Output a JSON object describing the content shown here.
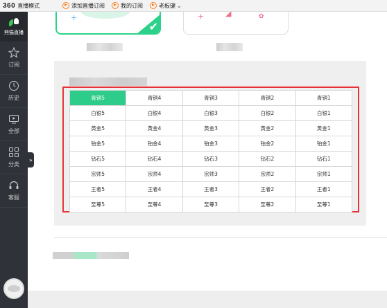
{
  "topbar": {
    "brand_number": "360",
    "brand_label": "直播模式",
    "items": [
      {
        "label": "添加直播订阅"
      },
      {
        "label": "我的订阅"
      },
      {
        "label": "老板键"
      }
    ]
  },
  "sidebar": {
    "logo_text": "熊猫直播",
    "items": [
      {
        "label": "订阅",
        "icon": "star-icon"
      },
      {
        "label": "历史",
        "icon": "clock-icon"
      },
      {
        "label": "全部",
        "icon": "tv-icon"
      },
      {
        "label": "分类",
        "icon": "grid-icon"
      },
      {
        "label": "客服",
        "icon": "headset-icon"
      }
    ],
    "expand_glyph": "»"
  },
  "rank_table": {
    "rows": [
      [
        "青铜5",
        "青铜4",
        "青铜3",
        "青铜2",
        "青铜1"
      ],
      [
        "白银5",
        "白银4",
        "白银3",
        "白银2",
        "白银1"
      ],
      [
        "黄金5",
        "黄金4",
        "黄金3",
        "黄金2",
        "黄金1"
      ],
      [
        "铂金5",
        "铂金4",
        "铂金3",
        "铂金2",
        "铂金1"
      ],
      [
        "钻石5",
        "钻石4",
        "钻石3",
        "钻石2",
        "钻石1"
      ],
      [
        "宗师5",
        "宗师4",
        "宗师3",
        "宗师2",
        "宗师1"
      ],
      [
        "王者5",
        "王者4",
        "王者3",
        "王者2",
        "王者1"
      ],
      [
        "至尊5",
        "至尊4",
        "至尊3",
        "至尊2",
        "至尊1"
      ]
    ],
    "selected": "青铜5"
  },
  "colors": {
    "accent_green": "#2ecc8a",
    "highlight_red": "#e8323a",
    "sidebar_bg": "#2f3238",
    "topbar_icon_orange": "#ff7d14"
  }
}
